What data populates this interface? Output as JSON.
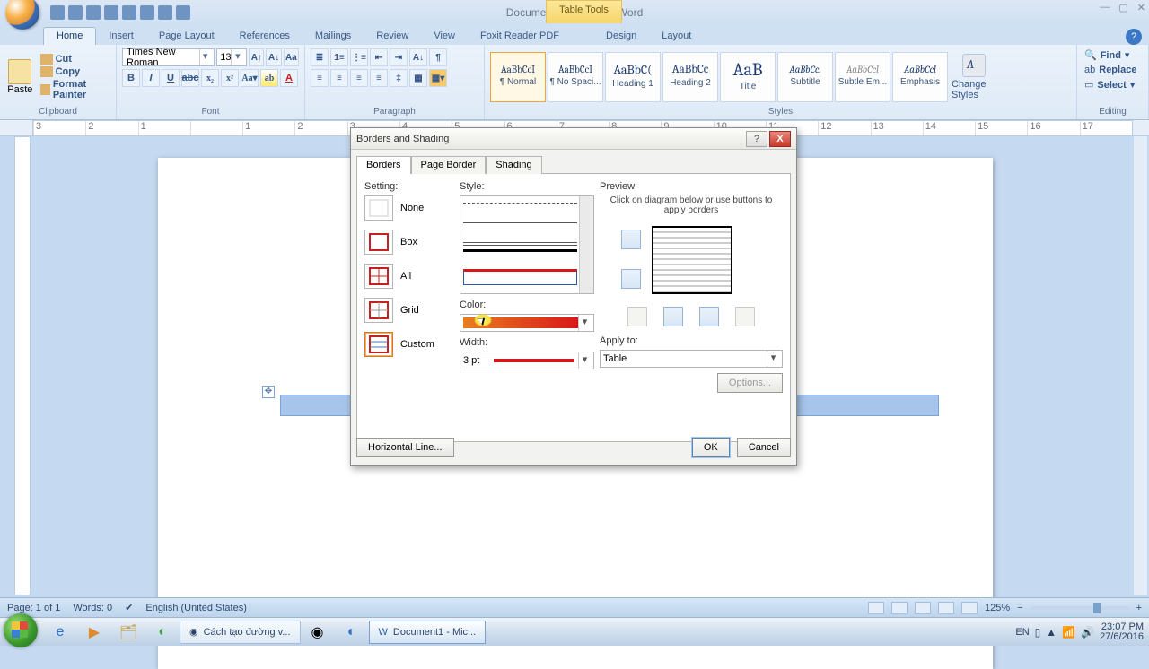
{
  "window": {
    "title": "Document1 - Microsoft Word",
    "contextual_tab": "Table Tools",
    "controls": {
      "min": "—",
      "max": "▢",
      "close": "✕"
    }
  },
  "qat": [
    "save",
    "undo",
    "redo",
    "new",
    "open",
    "print",
    "preview",
    "quick-print",
    "dd"
  ],
  "tabs": {
    "items": [
      "Home",
      "Insert",
      "Page Layout",
      "References",
      "Mailings",
      "Review",
      "View",
      "Foxit Reader PDF",
      "Design",
      "Layout"
    ],
    "active": "Home"
  },
  "ribbon": {
    "clipboard": {
      "name": "Clipboard",
      "paste": "Paste",
      "cut": "Cut",
      "copy": "Copy",
      "painter": "Format Painter"
    },
    "font": {
      "name": "Font",
      "family": "Times New Roman",
      "size": "13"
    },
    "paragraph": {
      "name": "Paragraph"
    },
    "styles": {
      "name": "Styles",
      "items": [
        {
          "preview": "AaBbCcI",
          "label": "¶ Normal",
          "selected": true
        },
        {
          "preview": "AaBbCcI",
          "label": "¶ No Spaci..."
        },
        {
          "preview": "AaBbC(",
          "label": "Heading 1"
        },
        {
          "preview": "AaBbCc",
          "label": "Heading 2"
        },
        {
          "preview": "AaB",
          "label": "Title"
        },
        {
          "preview": "AaBbCc.",
          "label": "Subtitle"
        },
        {
          "preview": "AaBbCcl",
          "label": "Subtle Em..."
        },
        {
          "preview": "AaBbCcl",
          "label": "Emphasis"
        }
      ],
      "change": "Change Styles"
    },
    "editing": {
      "name": "Editing",
      "find": "Find",
      "replace": "Replace",
      "select": "Select"
    }
  },
  "ruler_ticks": [
    "3",
    "2",
    "1",
    "",
    "1",
    "2",
    "3",
    "4",
    "5",
    "6",
    "7",
    "8",
    "9",
    "10",
    "11",
    "12",
    "13",
    "14",
    "15",
    "16",
    "17"
  ],
  "dialog": {
    "title": "Borders and Shading",
    "tabs": [
      "Borders",
      "Page Border",
      "Shading"
    ],
    "active_tab": "Borders",
    "setting_label": "Setting:",
    "settings": [
      "None",
      "Box",
      "All",
      "Grid",
      "Custom"
    ],
    "selected_setting": "Custom",
    "style_label": "Style:",
    "color_label": "Color:",
    "width_label": "Width:",
    "width_value": "3 pt",
    "preview_label": "Preview",
    "preview_hint": "Click on diagram below or use buttons to apply borders",
    "apply_label": "Apply to:",
    "apply_value": "Table",
    "options_btn": "Options...",
    "hline_btn": "Horizontal Line...",
    "ok": "OK",
    "cancel": "Cancel"
  },
  "status": {
    "page": "Page: 1 of 1",
    "words": "Words: 0",
    "lang": "English (United States)",
    "zoom": "125%"
  },
  "taskbar": {
    "tasks": [
      {
        "icon": "chrome",
        "label": "Cách tạo đường v..."
      },
      {
        "icon": "word",
        "label": "Document1 - Mic...",
        "active": true
      }
    ],
    "lang": "EN",
    "time": "23:07 PM",
    "date": "27/6/2016"
  }
}
